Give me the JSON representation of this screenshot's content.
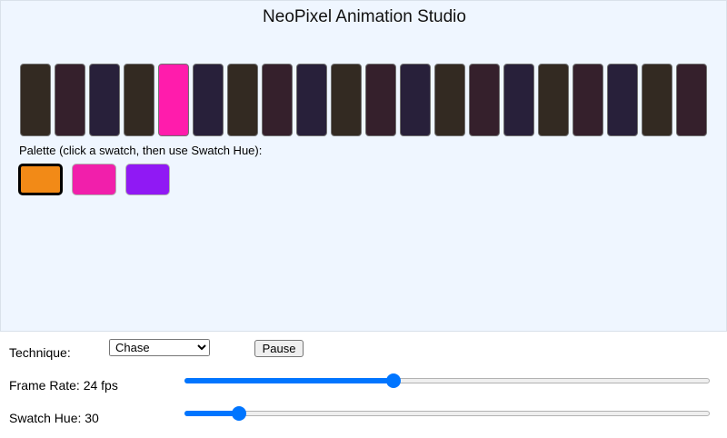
{
  "app": {
    "title": "NeoPixel Animation Studio"
  },
  "strip": {
    "leds": [
      "#332a22",
      "#35202c",
      "#28203a",
      "#332a22",
      "#ff1cac",
      "#28203a",
      "#332a22",
      "#35202c",
      "#28203a",
      "#332a22",
      "#35202c",
      "#28203a",
      "#332a22",
      "#35202c",
      "#28203a",
      "#332a22",
      "#35202c",
      "#28203a",
      "#332a22",
      "#35202c"
    ]
  },
  "palette": {
    "label": "Palette (click a swatch, then use Swatch Hue):",
    "swatches": [
      "#f28a17",
      "#f11fab",
      "#9019f4"
    ],
    "selected_index": 0
  },
  "controls": {
    "technique_label": "Technique:",
    "technique_selected": "Chase",
    "pause_label": "Pause",
    "frame_rate_label": "Frame Rate: 24 fps",
    "frame_rate_fraction": 0.395,
    "swatch_hue_label": "Swatch Hue: 30",
    "swatch_hue_fraction": 0.093
  }
}
